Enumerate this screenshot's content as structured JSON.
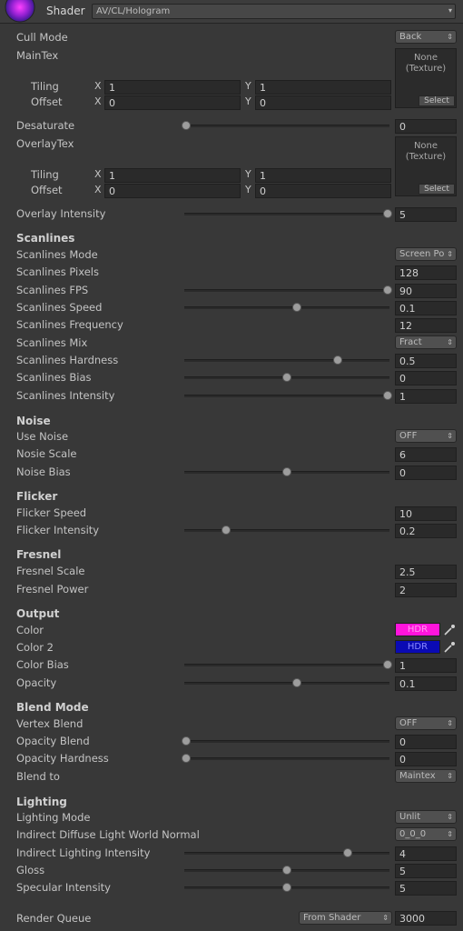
{
  "header": {
    "shader_label": "Shader",
    "shader_value": "AV/CL/Hologram",
    "icon": "shader-icon"
  },
  "cull_mode": {
    "label": "Cull Mode",
    "value": "Back"
  },
  "main_tex": {
    "label": "MainTex",
    "none_line1": "None",
    "none_line2": "(Texture)",
    "select_label": "Select",
    "tiling": {
      "label": "Tiling",
      "x_label": "X",
      "x": "1",
      "y_label": "Y",
      "y": "1"
    },
    "offset": {
      "label": "Offset",
      "x_label": "X",
      "x": "0",
      "y_label": "Y",
      "y": "0"
    }
  },
  "desaturate": {
    "label": "Desaturate",
    "value": "0",
    "slider": 0.0
  },
  "overlay_tex": {
    "label": "OverlayTex",
    "none_line1": "None",
    "none_line2": "(Texture)",
    "select_label": "Select",
    "tiling": {
      "label": "Tiling",
      "x_label": "X",
      "x": "1",
      "y_label": "Y",
      "y": "1"
    },
    "offset": {
      "label": "Offset",
      "x_label": "X",
      "x": "0",
      "y_label": "Y",
      "y": "0"
    }
  },
  "overlay_intensity": {
    "label": "Overlay Intensity",
    "value": "5",
    "slider": 1.0
  },
  "scanlines": {
    "header": "Scanlines",
    "mode": {
      "label": "Scanlines Mode",
      "value": "Screen Po"
    },
    "pixels": {
      "label": "Scanlines Pixels",
      "value": "128"
    },
    "fps": {
      "label": "Scanlines FPS",
      "value": "90",
      "slider": 1.0
    },
    "speed": {
      "label": "Scanlines Speed",
      "value": "0.1",
      "slider": 0.55
    },
    "frequency": {
      "label": "Scanlines Frequency",
      "value": "12"
    },
    "mix": {
      "label": "Scanlines Mix",
      "value": "Fract"
    },
    "hardness": {
      "label": "Scanlines Hardness",
      "value": "0.5",
      "slider": 0.75
    },
    "bias": {
      "label": "Scanlines Bias",
      "value": "0",
      "slider": 0.5
    },
    "intensity": {
      "label": "Scanlines Intensity",
      "value": "1",
      "slider": 1.0
    }
  },
  "noise": {
    "header": "Noise",
    "use": {
      "label": "Use Noise",
      "value": "OFF"
    },
    "scale": {
      "label": "Nosie Scale",
      "value": "6"
    },
    "bias": {
      "label": "Noise Bias",
      "value": "0",
      "slider": 0.5
    }
  },
  "flicker": {
    "header": "Flicker",
    "speed": {
      "label": "Flicker Speed",
      "value": "10"
    },
    "intensity": {
      "label": "Flicker Intensity",
      "value": "0.2",
      "slider": 0.2
    }
  },
  "fresnel": {
    "header": "Fresnel",
    "scale": {
      "label": "Fresnel Scale",
      "value": "2.5"
    },
    "power": {
      "label": "Fresnel Power",
      "value": "2"
    }
  },
  "output": {
    "header": "Output",
    "color": {
      "label": "Color",
      "text": "HDR",
      "swatch": "#ff14dc",
      "text_color": "#ff9cf0"
    },
    "color2": {
      "label": "Color 2",
      "text": "HDR",
      "swatch": "#0a0ab4",
      "text_color": "#8a8aff"
    },
    "bias": {
      "label": "Color Bias",
      "value": "1",
      "slider": 1.0
    },
    "opacity": {
      "label": "Opacity",
      "value": "0.1",
      "slider": 0.55
    }
  },
  "blend": {
    "header": "Blend Mode",
    "vertex": {
      "label": "Vertex Blend",
      "value": "OFF"
    },
    "opacity_blend": {
      "label": "Opacity Blend",
      "value": "0",
      "slider": 0.0
    },
    "opacity_hardness": {
      "label": "Opacity Hardness",
      "value": "0",
      "slider": 0.0
    },
    "blend_to": {
      "label": "Blend to",
      "value": "Maintex"
    }
  },
  "lighting": {
    "header": "Lighting",
    "mode": {
      "label": "Lighting Mode",
      "value": "Unlit"
    },
    "indirect_diffuse": {
      "label": "Indirect Diffuse Light World Normal",
      "value": "0_0_0"
    },
    "indirect_intensity": {
      "label": "Indirect Lighting Intensity",
      "value": "4",
      "slider": 0.8
    },
    "gloss": {
      "label": "Gloss",
      "value": "5",
      "slider": 0.5
    },
    "specular": {
      "label": "Specular Intensity",
      "value": "5",
      "slider": 0.5
    }
  },
  "render_queue": {
    "label": "Render Queue",
    "mode": "From Shader",
    "value": "3000"
  }
}
